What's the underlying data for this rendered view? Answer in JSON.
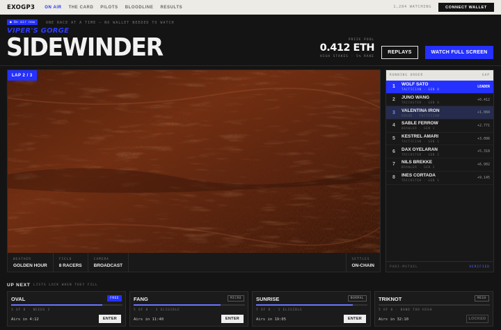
{
  "nav": {
    "logo": "EXOGP3",
    "items": [
      {
        "label": "ON AIR",
        "active": true
      },
      {
        "label": "THE CARD",
        "active": false
      },
      {
        "label": "PILOTS",
        "active": false
      },
      {
        "label": "BLOODLINE",
        "active": false
      },
      {
        "label": "RESULTS",
        "active": false
      }
    ],
    "watching": "1,284 WATCHING",
    "connect_label": "CONNECT WALLET"
  },
  "header": {
    "onair_badge": "● On air now",
    "tagline": "ONE RACE AT A TIME — NO WALLET NEEDED TO WATCH",
    "subtitle": "VIPER'S GORGE",
    "title": "SIDEWINDER",
    "prize_label": "PRIZE POOL",
    "prize_value": "0.412 ETH",
    "prize_sub": "HIGH STAKES · 5% RAKE",
    "replays_label": "REPLAYS",
    "watch_label": "WATCH FULL SCREEN"
  },
  "video": {
    "lap": "LAP 2 / 3",
    "info": [
      {
        "label": "WEATHER",
        "value": "GOLDEN HOUR"
      },
      {
        "label": "FIELD",
        "value": "8 RACERS"
      },
      {
        "label": "CAMERA",
        "value": "BROADCAST"
      }
    ],
    "settles_label": "SETTLES",
    "settles_value": "ON-CHAIN"
  },
  "order": {
    "title": "RUNNING ORDER",
    "gap_header": "GAP",
    "rows": [
      {
        "pos": "1",
        "name": "WOLF SATO",
        "sub": "TACTICIAN · GEN 0",
        "gap": "LEADER"
      },
      {
        "pos": "2",
        "name": "JUNO WANG",
        "sub": "TRICKSTER · GEN 0",
        "gap": "+0.412"
      },
      {
        "pos": "3",
        "name": "VALENTINA IRON",
        "sub": "VOGUE · TACTICIAN",
        "gap": "+1.084"
      },
      {
        "pos": "4",
        "name": "SABLE FERROW",
        "sub": "BRAWLER · GEN 1",
        "gap": "+2.771"
      },
      {
        "pos": "5",
        "name": "KESTREL AMARI",
        "sub": "TACTICIAN · GEN 1",
        "gap": "+3.006"
      },
      {
        "pos": "6",
        "name": "DAX OYELARAN",
        "sub": "TRICKSTER · GEN 2",
        "gap": "+5.318"
      },
      {
        "pos": "7",
        "name": "NILS BREKKE",
        "sub": "BRAWLER · GEN 2",
        "gap": "+6.902"
      },
      {
        "pos": "8",
        "name": "INES CORTADA",
        "sub": "TRICKSTER · GEN 1",
        "gap": "+9.145"
      }
    ],
    "footer_left": "PARI-MUTUEL",
    "footer_right": "VERIFIED"
  },
  "upnext": {
    "title": "UP NEXT",
    "subtitle": "LISTS LOCK WHEN THEY FILL",
    "cards": [
      {
        "name": "OVAL",
        "badge": "FREE",
        "meta": "3 OF 8 · NEEDS 2",
        "time": "Airs in 4:12",
        "action": "ENTER",
        "fill_fraction": 0.82
      },
      {
        "name": "FANG",
        "badge": "MICRO",
        "meta": "5 OF 8 · 3 ELIGIBLE",
        "time": "Airs in 11:40",
        "action": "ENTER",
        "fill_fraction": 0.78
      },
      {
        "name": "SUNRISE",
        "badge": "NORMAL",
        "meta": "7 OF 8 · 1 ELIGIBLE",
        "time": "Airs in 19:05",
        "action": "ENTER",
        "fill_fraction": 0.87
      },
      {
        "name": "TRIKNOT",
        "badge": "MEGA",
        "meta": "5 OF 8 · BAND TOO HIGH",
        "time": "Airs in 32:10",
        "action": "LOCKED",
        "fill_fraction": 0.0
      }
    ]
  },
  "colors": {
    "accent": "#2531ff",
    "background": "#141414",
    "canyon": "#7a2e12"
  }
}
